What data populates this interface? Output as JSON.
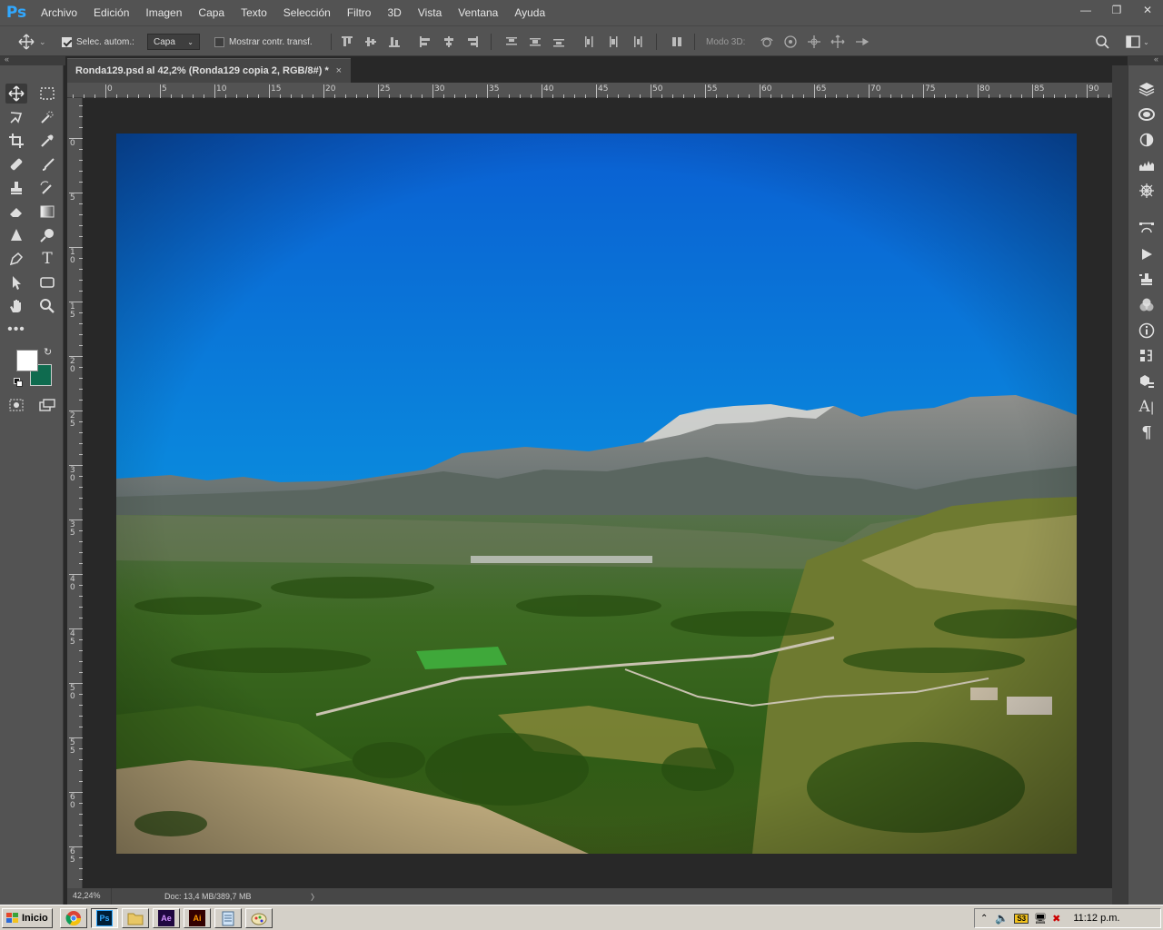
{
  "app": {
    "logo": "Ps"
  },
  "menu": [
    "Archivo",
    "Edición",
    "Imagen",
    "Capa",
    "Texto",
    "Selección",
    "Filtro",
    "3D",
    "Vista",
    "Ventana",
    "Ayuda"
  ],
  "window_controls": {
    "minimize": "minimize-icon",
    "restore": "restore-icon",
    "close": "close-icon"
  },
  "options": {
    "auto_select_label": "Selec. autom.:",
    "auto_select_checked": true,
    "auto_select_value": "Capa",
    "transform_label": "Mostrar contr. transf.",
    "transform_checked": false,
    "mode3d_label": "Modo 3D:"
  },
  "document": {
    "tab_title": "Ronda129.psd al 42,2% (Ronda129 copia 2, RGB/8#) *",
    "close": "×",
    "zoom": "42,24%",
    "doc_info": "Doc: 13,4 MB/389,7 MB",
    "arrow": "〉"
  },
  "ruler": {
    "top_labels": [
      "0",
      "5",
      "10",
      "15",
      "20",
      "25",
      "30",
      "35",
      "40",
      "45",
      "50",
      "55",
      "60",
      "65",
      "70",
      "75",
      "80",
      "85",
      "90"
    ],
    "left_labels": [
      "0",
      "5",
      "1\n0",
      "1\n5",
      "2\n0",
      "2\n5",
      "3\n0",
      "3\n5",
      "4\n0",
      "4\n5",
      "5\n0",
      "5\n5",
      "6\n0",
      "6\n5"
    ]
  },
  "colors": {
    "foreground": "#ffffff",
    "background": "#0f6b4f",
    "ps_blue": "#31a8ff"
  },
  "taskbar": {
    "start_label": "Inicio",
    "clock": "11:12 p.m."
  }
}
